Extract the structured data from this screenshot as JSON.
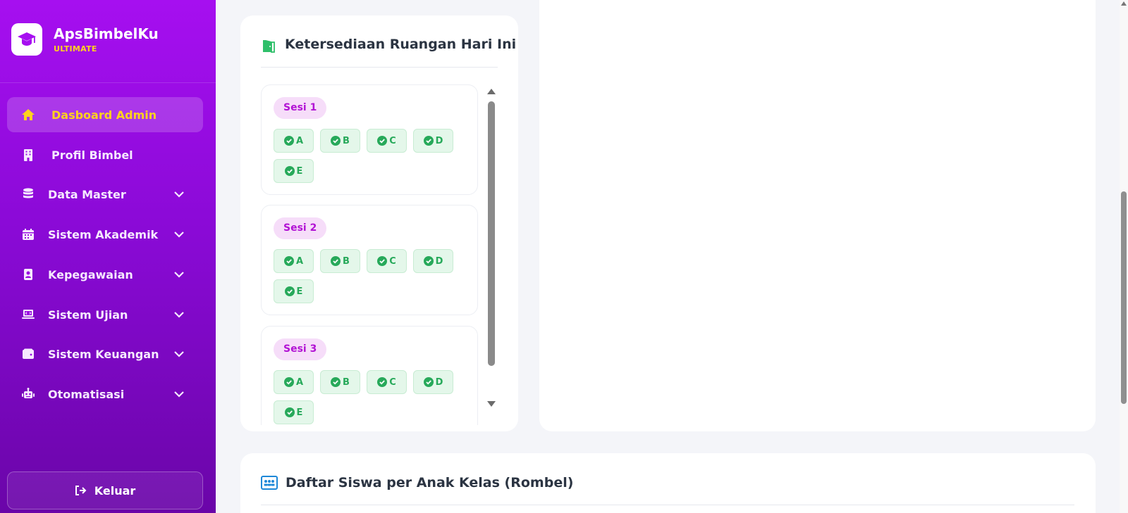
{
  "brand": {
    "name": "ApsBimbelKu",
    "tier": "ULTIMATE"
  },
  "sidebar": {
    "items": [
      {
        "label": "Dasboard Admin",
        "icon": "home-icon",
        "active": true
      },
      {
        "label": "Profil Bimbel",
        "icon": "building-icon"
      },
      {
        "label": "Data Master",
        "icon": "database-icon",
        "expandable": true
      },
      {
        "label": "Sistem Akademik",
        "icon": "calendar-icon",
        "expandable": true
      },
      {
        "label": "Kepegawaian",
        "icon": "id-badge-icon",
        "expandable": true
      },
      {
        "label": "Sistem Ujian",
        "icon": "laptop-code-icon",
        "expandable": true
      },
      {
        "label": "Sistem Keuangan",
        "icon": "wallet-icon",
        "expandable": true
      },
      {
        "label": "Otomatisasi",
        "icon": "robot-icon",
        "expandable": true
      }
    ],
    "logout_label": "Keluar"
  },
  "room_availability": {
    "title": "Ketersediaan Ruangan Hari Ini",
    "sessions": [
      {
        "label": "Sesi 1",
        "rooms": [
          "A",
          "B",
          "C",
          "D",
          "E"
        ]
      },
      {
        "label": "Sesi 2",
        "rooms": [
          "A",
          "B",
          "C",
          "D",
          "E"
        ]
      },
      {
        "label": "Sesi 3",
        "rooms": [
          "A",
          "B",
          "C",
          "D",
          "E"
        ]
      }
    ]
  },
  "rombel": {
    "title": "Daftar Siswa per Anak Kelas (Rombel)"
  },
  "colors": {
    "sidebar_top": "#a60ff0",
    "sidebar_bottom": "#6a05a8",
    "active_accent": "#ffd21e",
    "available_green": "#27a95a",
    "session_badge": "#b213d4"
  }
}
